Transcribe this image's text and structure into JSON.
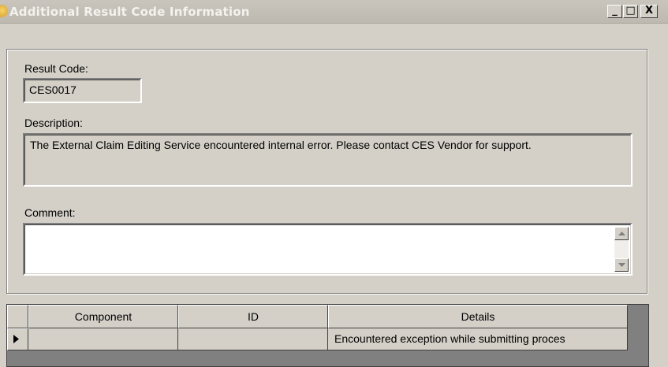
{
  "window": {
    "title": "Additional Result Code Information",
    "minimize_glyph": "_",
    "maximize_glyph": "□",
    "close_glyph": "X"
  },
  "result_code": {
    "label": "Result Code:",
    "value": "CES0017"
  },
  "description": {
    "label": "Description:",
    "value": "The External Claim Editing Service encountered internal error. Please contact CES Vendor for support."
  },
  "comment": {
    "label": "Comment:",
    "value": ""
  },
  "grid": {
    "columns": [
      "Component",
      "ID",
      "Details"
    ],
    "rows": [
      {
        "component": "",
        "id": "",
        "details": "Encountered exception while submitting proces"
      }
    ]
  },
  "icons": {
    "app": "app-icon",
    "row_indicator": "arrow-right-icon",
    "scroll_up": "scroll-up-icon",
    "scroll_down": "scroll-down-icon"
  }
}
